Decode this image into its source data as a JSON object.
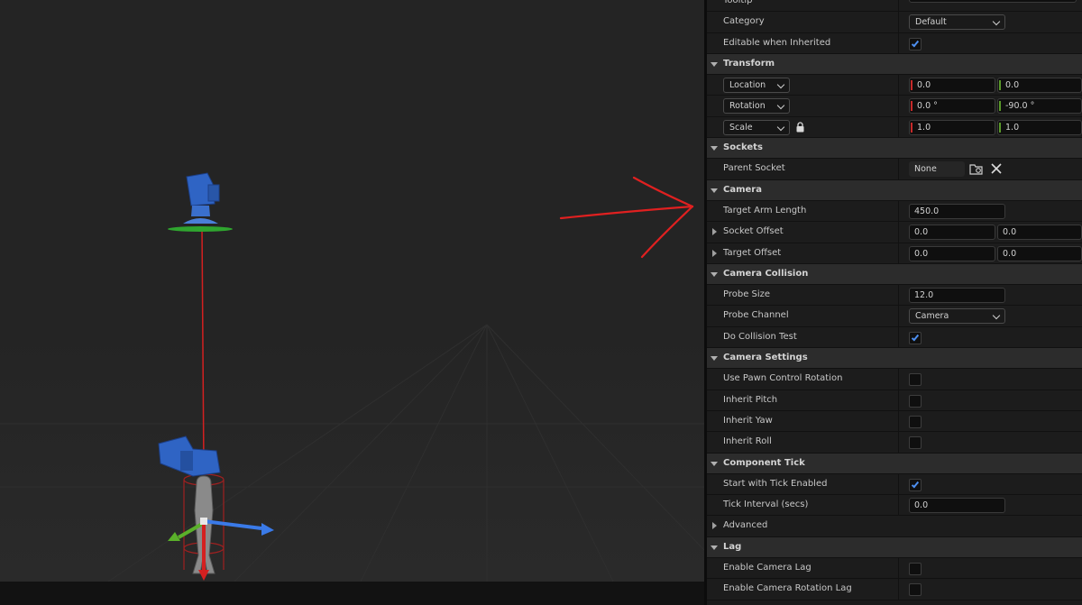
{
  "viewport": {
    "annotation_color": "#e02020",
    "grid_color": "#2e2e2e"
  },
  "details": {
    "rows": [
      {
        "type": "prop",
        "label": "Tooltip",
        "kind": "text",
        "value": ""
      },
      {
        "type": "prop",
        "label": "Category",
        "kind": "dropdown",
        "value": "Default"
      },
      {
        "type": "prop",
        "label": "Editable when Inherited",
        "kind": "checkbox",
        "checked": true
      },
      {
        "type": "section",
        "label": "Transform"
      },
      {
        "type": "transform",
        "label": "Location",
        "x": "0.0",
        "y": "0.0"
      },
      {
        "type": "transform",
        "label": "Rotation",
        "x": "0.0 °",
        "y": "-90.0 °"
      },
      {
        "type": "transform",
        "label": "Scale",
        "x": "1.0",
        "y": "1.0",
        "lock": true
      },
      {
        "type": "section",
        "label": "Sockets"
      },
      {
        "type": "prop",
        "label": "Parent Socket",
        "kind": "socket",
        "value": "None"
      },
      {
        "type": "section",
        "label": "Camera"
      },
      {
        "type": "prop",
        "label": "Target Arm Length",
        "kind": "number",
        "value": "450.0"
      },
      {
        "type": "vector",
        "label": "Socket Offset",
        "x": "0.0",
        "y": "0.0"
      },
      {
        "type": "vector",
        "label": "Target Offset",
        "x": "0.0",
        "y": "0.0"
      },
      {
        "type": "section",
        "label": "Camera Collision"
      },
      {
        "type": "prop",
        "label": "Probe Size",
        "kind": "number",
        "value": "12.0"
      },
      {
        "type": "prop",
        "label": "Probe Channel",
        "kind": "dropdown",
        "value": "Camera"
      },
      {
        "type": "prop",
        "label": "Do Collision Test",
        "kind": "checkbox",
        "checked": true
      },
      {
        "type": "section",
        "label": "Camera Settings"
      },
      {
        "type": "prop",
        "label": "Use Pawn Control Rotation",
        "kind": "checkbox",
        "checked": false
      },
      {
        "type": "prop",
        "label": "Inherit Pitch",
        "kind": "checkbox",
        "checked": false
      },
      {
        "type": "prop",
        "label": "Inherit Yaw",
        "kind": "checkbox",
        "checked": false
      },
      {
        "type": "prop",
        "label": "Inherit Roll",
        "kind": "checkbox",
        "checked": false
      },
      {
        "type": "section",
        "label": "Component Tick"
      },
      {
        "type": "prop",
        "label": "Start with Tick Enabled",
        "kind": "checkbox",
        "checked": true
      },
      {
        "type": "prop",
        "label": "Tick Interval (secs)",
        "kind": "number",
        "value": "0.0"
      },
      {
        "type": "collapsed",
        "label": "Advanced"
      },
      {
        "type": "section",
        "label": "Lag"
      },
      {
        "type": "prop",
        "label": "Enable Camera Lag",
        "kind": "checkbox",
        "checked": false
      },
      {
        "type": "prop",
        "label": "Enable Camera Rotation Lag",
        "kind": "checkbox",
        "checked": false
      }
    ],
    "colors": {
      "check": "#4d8ff0",
      "axis_x": "#c62a2a",
      "axis_y": "#5a9a2a"
    }
  }
}
